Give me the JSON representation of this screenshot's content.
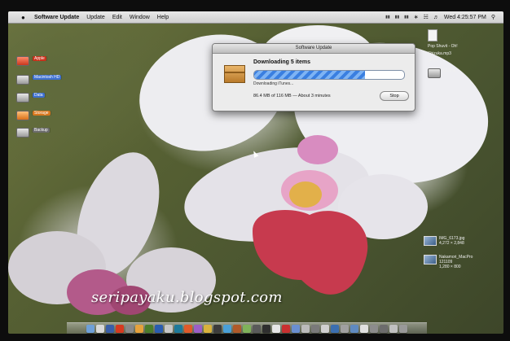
{
  "menubar": {
    "apple_icon": "apple-icon",
    "app_name": "Software Update",
    "items": [
      "Update",
      "Edit",
      "Window",
      "Help"
    ],
    "clock": "Wed 4:25:57 PM"
  },
  "update_window": {
    "title": "Software Update",
    "heading": "Downloading 5 items",
    "status": "Downloading iTunes...",
    "amount": "86.4 MB of 116 MB — About 3 minutes",
    "stop_label": "Stop",
    "progress_fraction": 0.74,
    "icon": "package-box-icon"
  },
  "desktop_left": [
    {
      "name": "Apple",
      "color": "red"
    },
    {
      "name": "Macintosh HD",
      "color": "blue"
    },
    {
      "name": "Data",
      "color": "blue"
    },
    {
      "name": "Storage",
      "color": "orange"
    },
    {
      "name": "Backup",
      "color": "grey"
    }
  ],
  "desktop_right": {
    "mp3_line1": "Pop Shuvit - Oh!",
    "mp3_line2": "Shizuka.mp3",
    "mp3_line3": "04:26",
    "drive_label": "BLANK",
    "img1_name": "IMG_6173.jpg",
    "img1_size": "4,272 × 2,848",
    "img2_name": "Nakamori_MacPro",
    "img2_sub": "121109",
    "img2_size": "1,280 × 800"
  },
  "watermark": "seripayaku.blogspot.com",
  "dock_colors": [
    "#6fa0d8",
    "#d9d9d9",
    "#3a5fa8",
    "#d63a1f",
    "#8a8a8a",
    "#e6a23c",
    "#4b7d2b",
    "#2a5db0",
    "#c7c7c7",
    "#1f7a9a",
    "#e05a2a",
    "#9b5fc7",
    "#d9b23c",
    "#3c3c3c",
    "#4aa0d8",
    "#b05a2a",
    "#7fb25a",
    "#5a5a5a",
    "#2f2f2f",
    "#e6e6e6",
    "#c93030",
    "#6a8fd0",
    "#bbbbbb",
    "#7a7a7a",
    "#d0d0d0",
    "#3b6fb0",
    "#a0a0a0",
    "#5f8ac0",
    "#e0e0e0",
    "#8c8c8c",
    "#6c6c6c",
    "#c0c0c0",
    "#999999"
  ]
}
